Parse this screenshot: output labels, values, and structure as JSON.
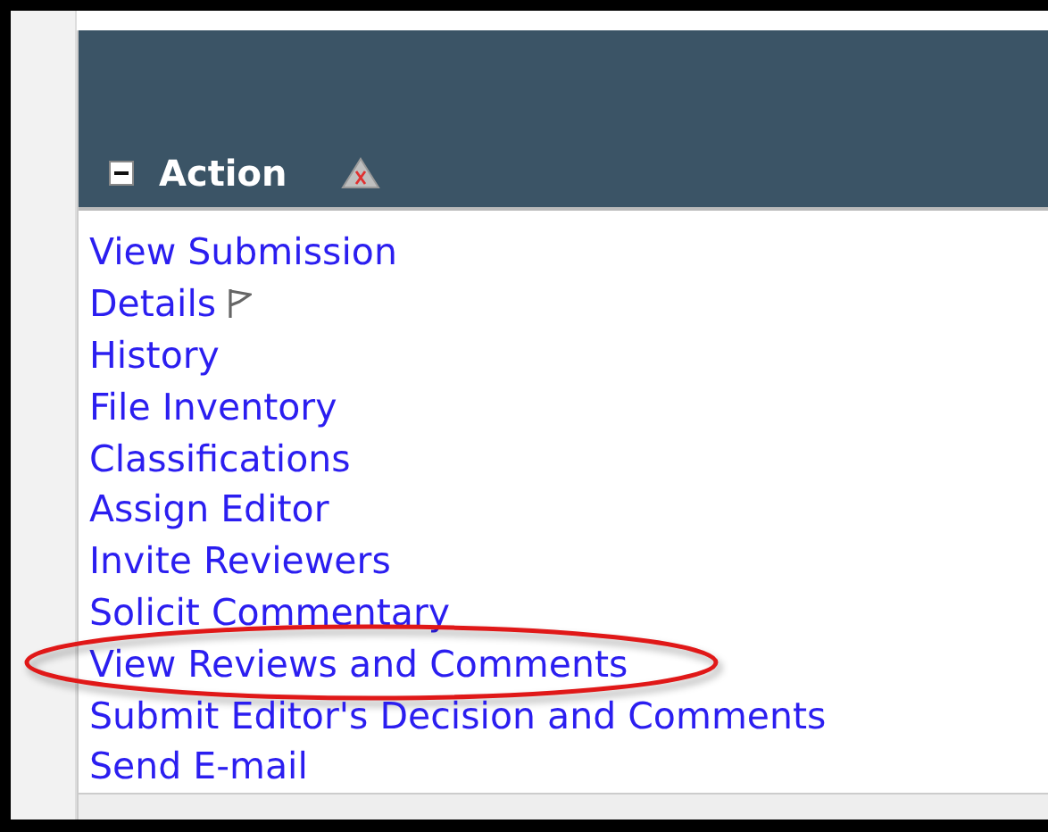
{
  "header": {
    "title": "Action",
    "collapsed": false
  },
  "actions": [
    {
      "label": "View Submission",
      "flag": false,
      "circled": false
    },
    {
      "label": "Details",
      "flag": true,
      "circled": false
    },
    {
      "label": "History",
      "flag": false,
      "circled": false
    },
    {
      "label": "File Inventory",
      "flag": false,
      "circled": false
    },
    {
      "label": "Classifications",
      "flag": false,
      "circled": false
    },
    {
      "label": "Assign Editor",
      "flag": false,
      "circled": false
    },
    {
      "label": "Invite Reviewers",
      "flag": false,
      "circled": false
    },
    {
      "label": "Solicit Commentary",
      "flag": false,
      "circled": false
    },
    {
      "label": "View Reviews and Comments",
      "flag": false,
      "circled": true
    },
    {
      "label": "Submit Editor's Decision and Comments",
      "flag": false,
      "circled": false
    },
    {
      "label": "Send E-mail",
      "flag": false,
      "circled": false
    }
  ]
}
